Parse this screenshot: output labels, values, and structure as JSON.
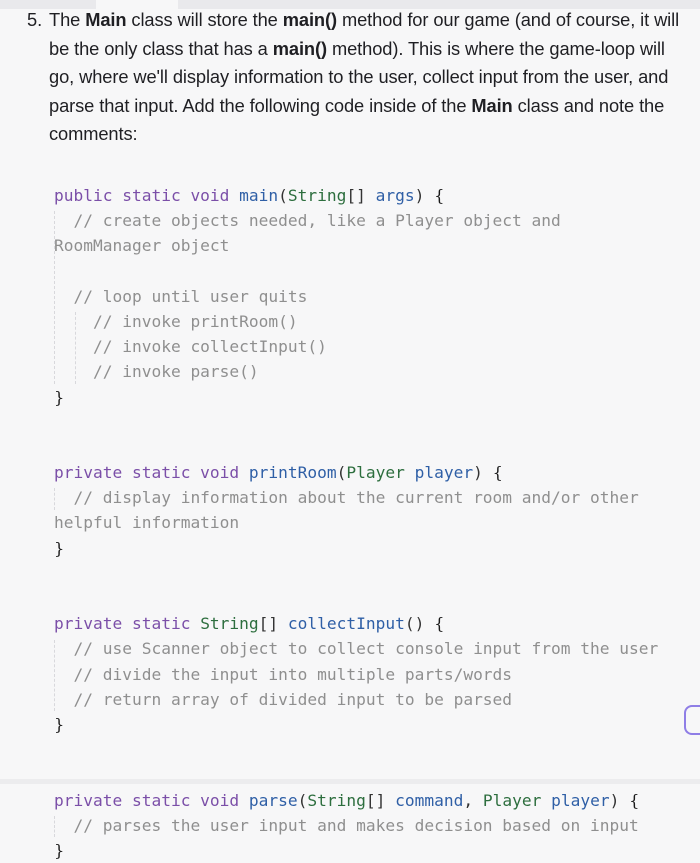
{
  "instruction": {
    "number": "5.",
    "segments": [
      {
        "text": "The ",
        "bold": false
      },
      {
        "text": "Main",
        "bold": true
      },
      {
        "text": " class will store the ",
        "bold": false
      },
      {
        "text": "main()",
        "bold": true
      },
      {
        "text": " method for our game (and of course, it will be the only class that has a ",
        "bold": false
      },
      {
        "text": "main()",
        "bold": true
      },
      {
        "text": " method). This is where the game-loop will go, where we'll display information to the user, collect input from the user, and parse that input. Add the following code inside of the ",
        "bold": false
      },
      {
        "text": "Main",
        "bold": true
      },
      {
        "text": " class and note the comments:",
        "bold": false
      }
    ]
  },
  "code": {
    "language": "java",
    "lines": [
      [
        {
          "t": "public static void ",
          "c": "kw"
        },
        {
          "t": "main",
          "c": "fn"
        },
        {
          "t": "(",
          "c": "pu"
        },
        {
          "t": "String",
          "c": "ty"
        },
        {
          "t": "[] ",
          "c": "pu"
        },
        {
          "t": "args",
          "c": "fn"
        },
        {
          "t": ") ",
          "c": "pu"
        },
        {
          "t": "{",
          "c": "br"
        }
      ],
      [
        {
          "t": "  // create objects needed, like a Player object and",
          "c": "cm"
        }
      ],
      [
        {
          "t": "RoomManager object",
          "c": "cm"
        }
      ],
      [
        {
          "t": "",
          "c": "cm"
        }
      ],
      [
        {
          "t": "  // loop until user quits",
          "c": "cm"
        }
      ],
      [
        {
          "t": "    // invoke printRoom()",
          "c": "cm"
        }
      ],
      [
        {
          "t": "    // invoke collectInput()",
          "c": "cm"
        }
      ],
      [
        {
          "t": "    // invoke parse()",
          "c": "cm"
        }
      ],
      [
        {
          "t": "}",
          "c": "br"
        }
      ],
      [
        {
          "t": "",
          "c": "cm"
        }
      ],
      [
        {
          "t": "",
          "c": "cm"
        }
      ],
      [
        {
          "t": "private static void ",
          "c": "kw"
        },
        {
          "t": "printRoom",
          "c": "fn"
        },
        {
          "t": "(",
          "c": "pu"
        },
        {
          "t": "Player",
          "c": "ty"
        },
        {
          "t": " ",
          "c": "pu"
        },
        {
          "t": "player",
          "c": "fn"
        },
        {
          "t": ") ",
          "c": "pu"
        },
        {
          "t": "{",
          "c": "br"
        }
      ],
      [
        {
          "t": "  // display information about the current room and/or other",
          "c": "cm"
        }
      ],
      [
        {
          "t": "helpful information",
          "c": "cm"
        }
      ],
      [
        {
          "t": "}",
          "c": "br"
        }
      ],
      [
        {
          "t": "",
          "c": "cm"
        }
      ],
      [
        {
          "t": "",
          "c": "cm"
        }
      ],
      [
        {
          "t": "private static ",
          "c": "kw"
        },
        {
          "t": "String",
          "c": "ty"
        },
        {
          "t": "[] ",
          "c": "pu"
        },
        {
          "t": "collectInput",
          "c": "fn"
        },
        {
          "t": "() ",
          "c": "pu"
        },
        {
          "t": "{",
          "c": "br"
        }
      ],
      [
        {
          "t": "  // use Scanner object to collect console input from the user",
          "c": "cm"
        }
      ],
      [
        {
          "t": "  // divide the input into multiple parts/words",
          "c": "cm"
        }
      ],
      [
        {
          "t": "  // return array of divided input to be parsed",
          "c": "cm"
        }
      ],
      [
        {
          "t": "}",
          "c": "br"
        }
      ],
      [
        {
          "t": "",
          "c": "cm"
        }
      ],
      [
        {
          "t": "",
          "c": "cm"
        }
      ],
      [
        {
          "t": "private static void ",
          "c": "kw"
        },
        {
          "t": "parse",
          "c": "fn"
        },
        {
          "t": "(",
          "c": "pu"
        },
        {
          "t": "String",
          "c": "ty"
        },
        {
          "t": "[] ",
          "c": "pu"
        },
        {
          "t": "command",
          "c": "fn"
        },
        {
          "t": ", ",
          "c": "pu"
        },
        {
          "t": "Player",
          "c": "ty"
        },
        {
          "t": " ",
          "c": "pu"
        },
        {
          "t": "player",
          "c": "fn"
        },
        {
          "t": ") ",
          "c": "pu"
        },
        {
          "t": "{",
          "c": "br"
        }
      ],
      [
        {
          "t": "  // parses the user input and makes decision based on input",
          "c": "cm"
        }
      ],
      [
        {
          "t": "}",
          "c": "br"
        }
      ]
    ]
  },
  "colors": {
    "keyword": "#7b4fa8",
    "function": "#2f5fa6",
    "type": "#2d6e3e",
    "comment": "#8f8f8f",
    "background": "#f7f7f8",
    "side_tab_accent": "#8f7ee6"
  }
}
